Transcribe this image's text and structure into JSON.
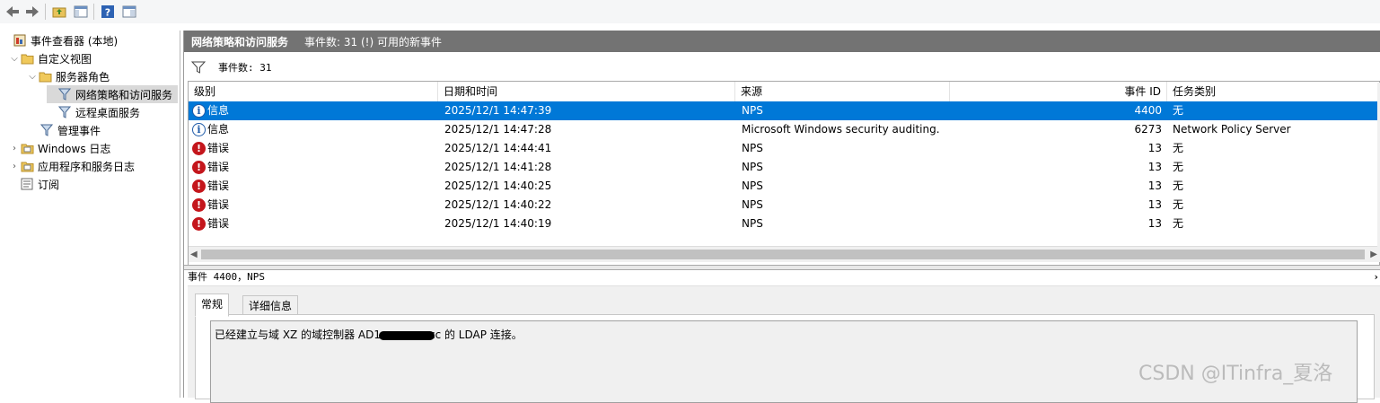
{
  "toolbar": {
    "buttons": [
      "back-icon",
      "forward-icon",
      "folder-up-icon",
      "show-hide-tree-icon",
      "help-icon",
      "show-hide-action-pane-icon"
    ]
  },
  "tree": {
    "items": [
      {
        "label": "事件查看器 (本地)"
      },
      {
        "label": "自定义视图"
      },
      {
        "label": "服务器角色"
      },
      {
        "label": "网络策略和访问服务"
      },
      {
        "label": "远程桌面服务"
      },
      {
        "label": "管理事件"
      },
      {
        "label": "Windows 日志"
      },
      {
        "label": "应用程序和服务日志"
      },
      {
        "label": "订阅"
      }
    ]
  },
  "panel": {
    "title": "网络策略和访问服务",
    "subtitle": "事件数: 31 (!) 可用的新事件"
  },
  "filter": {
    "count_label": "事件数: 31"
  },
  "table": {
    "headers": [
      "级别",
      "日期和时间",
      "来源",
      "事件 ID",
      "任务类别"
    ],
    "rows": [
      {
        "level": "信息",
        "type": "info",
        "datetime": "2025/12/1 14:47:39",
        "source": "NPS",
        "event_id": "4400",
        "category": "无",
        "selected": true
      },
      {
        "level": "信息",
        "type": "info",
        "datetime": "2025/12/1 14:47:28",
        "source": "Microsoft Windows security auditing.",
        "event_id": "6273",
        "category": "Network Policy Server"
      },
      {
        "level": "错误",
        "type": "error",
        "datetime": "2025/12/1 14:44:41",
        "source": "NPS",
        "event_id": "13",
        "category": "无"
      },
      {
        "level": "错误",
        "type": "error",
        "datetime": "2025/12/1 14:41:28",
        "source": "NPS",
        "event_id": "13",
        "category": "无"
      },
      {
        "level": "错误",
        "type": "error",
        "datetime": "2025/12/1 14:40:25",
        "source": "NPS",
        "event_id": "13",
        "category": "无"
      },
      {
        "level": "错误",
        "type": "error",
        "datetime": "2025/12/1 14:40:22",
        "source": "NPS",
        "event_id": "13",
        "category": "无"
      },
      {
        "level": "错误",
        "type": "error",
        "datetime": "2025/12/1 14:40:19",
        "source": "NPS",
        "event_id": "13",
        "category": "无"
      }
    ]
  },
  "detail": {
    "title": "事件 4400，NPS",
    "tabs": [
      "常规",
      "详细信息"
    ],
    "message_before": "已经建立与域 XZ 的域控制器 AD1",
    "message_after": "cc 的 LDAP 连接。"
  },
  "watermark": "CSDN @ITinfra_夏洛",
  "colors": {
    "selection": "#0078d7",
    "header_bar": "#737373",
    "error": "#c4161c",
    "info": "#1e5aa8"
  }
}
